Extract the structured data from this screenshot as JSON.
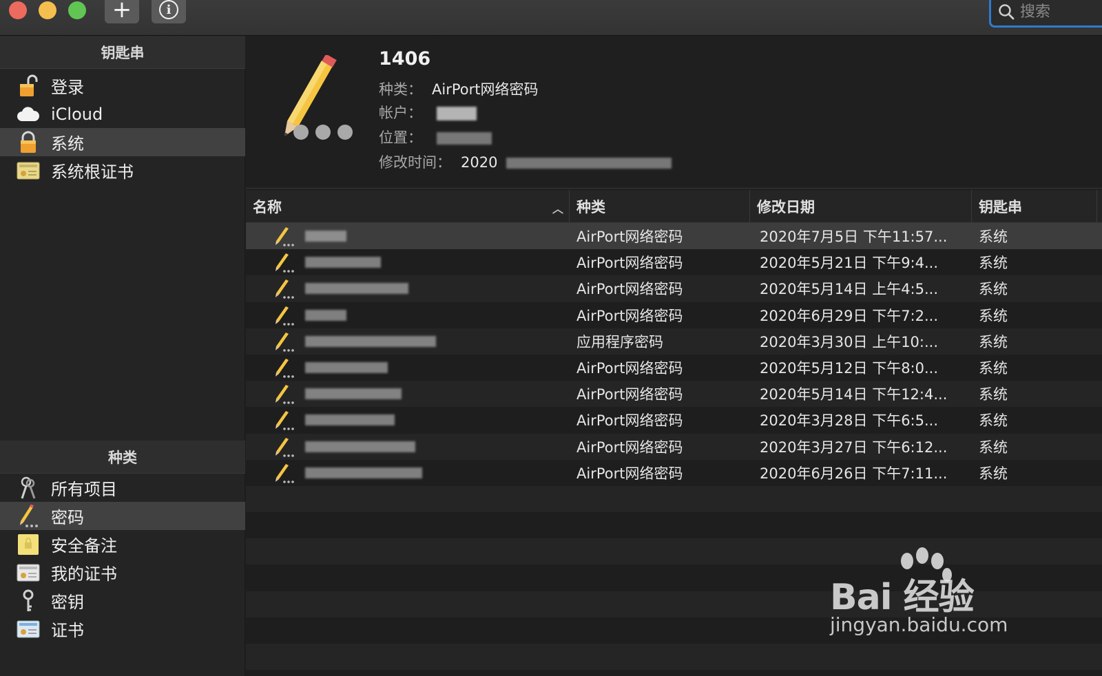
{
  "window": {
    "toolbar": {
      "add_label": "+",
      "info_label": "i"
    },
    "search": {
      "placeholder": "搜索",
      "value": ""
    }
  },
  "sidebar": {
    "keychains_header": "钥匙串",
    "keychains": [
      {
        "label": "登录",
        "icon": "unlocked-padlock-icon"
      },
      {
        "label": "iCloud",
        "icon": "cloud-icon"
      },
      {
        "label": "系统",
        "icon": "padlock-icon",
        "selected": true
      },
      {
        "label": "系统根证书",
        "icon": "certificate-icon"
      }
    ],
    "categories_header": "种类",
    "categories": [
      {
        "label": "所有项目",
        "icon": "keys-icon"
      },
      {
        "label": "密码",
        "icon": "pencil-icon",
        "selected": true
      },
      {
        "label": "安全备注",
        "icon": "secure-note-icon"
      },
      {
        "label": "我的证书",
        "icon": "my-certificate-icon"
      },
      {
        "label": "密钥",
        "icon": "key-icon"
      },
      {
        "label": "证书",
        "icon": "certificate-icon"
      }
    ]
  },
  "detail": {
    "title": "1406",
    "kind_label": "种类：",
    "kind_value": "AirPort网络密码",
    "account_label": "帐户：",
    "location_label": "位置：",
    "modified_label": "修改时间：",
    "modified_value": "2020"
  },
  "table": {
    "columns": {
      "name": "名称",
      "kind": "种类",
      "date": "修改日期",
      "keychain": "钥匙串"
    },
    "rows": [
      {
        "kind": "AirPort网络密码",
        "date": "2020年7月5日 下午11:57...",
        "keychain": "系统"
      },
      {
        "kind": "AirPort网络密码",
        "date": "2020年5月21日 下午9:4...",
        "keychain": "系统"
      },
      {
        "kind": "AirPort网络密码",
        "date": "2020年5月14日 上午4:5...",
        "keychain": "系统"
      },
      {
        "kind": "AirPort网络密码",
        "date": "2020年6月29日 下午7:2...",
        "keychain": "系统"
      },
      {
        "kind": "应用程序密码",
        "date": "2020年3月30日 上午10:...",
        "keychain": "系统"
      },
      {
        "kind": "AirPort网络密码",
        "date": "2020年5月12日 下午8:0...",
        "keychain": "系统"
      },
      {
        "kind": "AirPort网络密码",
        "date": "2020年5月14日 下午12:4...",
        "keychain": "系统"
      },
      {
        "kind": "AirPort网络密码",
        "date": "2020年3月28日 下午6:5...",
        "keychain": "系统"
      },
      {
        "kind": "AirPort网络密码",
        "date": "2020年3月27日 下午6:12...",
        "keychain": "系统"
      },
      {
        "kind": "AirPort网络密码",
        "date": "2020年6月26日 下午7:11...",
        "keychain": "系统"
      }
    ]
  },
  "watermark": {
    "brand": "Bai 经验",
    "url": "jingyan.baidu.com"
  }
}
